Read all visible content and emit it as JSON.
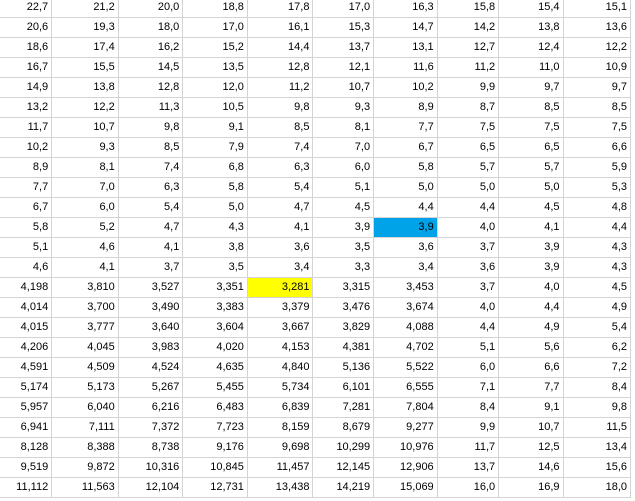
{
  "sheet": {
    "highlight_colors": {
      "yellow": "#ffff00",
      "blue": "#00a2e8"
    },
    "highlighted_cells": [
      {
        "row": 14,
        "col": 4,
        "color": "yellow"
      },
      {
        "row": 11,
        "col": 6,
        "color": "blue"
      }
    ],
    "rows": [
      [
        "22,7",
        "21,2",
        "20,0",
        "18,8",
        "17,8",
        "17,0",
        "16,3",
        "15,8",
        "15,4",
        "15,1"
      ],
      [
        "20,6",
        "19,3",
        "18,0",
        "17,0",
        "16,1",
        "15,3",
        "14,7",
        "14,2",
        "13,8",
        "13,6"
      ],
      [
        "18,6",
        "17,4",
        "16,2",
        "15,2",
        "14,4",
        "13,7",
        "13,1",
        "12,7",
        "12,4",
        "12,2"
      ],
      [
        "16,7",
        "15,5",
        "14,5",
        "13,5",
        "12,8",
        "12,1",
        "11,6",
        "11,2",
        "11,0",
        "10,9"
      ],
      [
        "14,9",
        "13,8",
        "12,8",
        "12,0",
        "11,2",
        "10,7",
        "10,2",
        "9,9",
        "9,7",
        "9,7"
      ],
      [
        "13,2",
        "12,2",
        "11,3",
        "10,5",
        "9,8",
        "9,3",
        "8,9",
        "8,7",
        "8,5",
        "8,5"
      ],
      [
        "11,7",
        "10,7",
        "9,8",
        "9,1",
        "8,5",
        "8,1",
        "7,7",
        "7,5",
        "7,5",
        "7,5"
      ],
      [
        "10,2",
        "9,3",
        "8,5",
        "7,9",
        "7,4",
        "7,0",
        "6,7",
        "6,5",
        "6,5",
        "6,6"
      ],
      [
        "8,9",
        "8,1",
        "7,4",
        "6,8",
        "6,3",
        "6,0",
        "5,8",
        "5,7",
        "5,7",
        "5,9"
      ],
      [
        "7,7",
        "7,0",
        "6,3",
        "5,8",
        "5,4",
        "5,1",
        "5,0",
        "5,0",
        "5,0",
        "5,3"
      ],
      [
        "6,7",
        "6,0",
        "5,4",
        "5,0",
        "4,7",
        "4,5",
        "4,4",
        "4,4",
        "4,5",
        "4,8"
      ],
      [
        "5,8",
        "5,2",
        "4,7",
        "4,3",
        "4,1",
        "3,9",
        "3,9",
        "4,0",
        "4,1",
        "4,4"
      ],
      [
        "5,1",
        "4,6",
        "4,1",
        "3,8",
        "3,6",
        "3,5",
        "3,6",
        "3,7",
        "3,9",
        "4,3"
      ],
      [
        "4,6",
        "4,1",
        "3,7",
        "3,5",
        "3,4",
        "3,3",
        "3,4",
        "3,6",
        "3,9",
        "4,3"
      ],
      [
        "4,198",
        "3,810",
        "3,527",
        "3,351",
        "3,281",
        "3,315",
        "3,453",
        "3,7",
        "4,0",
        "4,5"
      ],
      [
        "4,014",
        "3,700",
        "3,490",
        "3,383",
        "3,379",
        "3,476",
        "3,674",
        "4,0",
        "4,4",
        "4,9"
      ],
      [
        "4,015",
        "3,777",
        "3,640",
        "3,604",
        "3,667",
        "3,829",
        "4,088",
        "4,4",
        "4,9",
        "5,4"
      ],
      [
        "4,206",
        "4,045",
        "3,983",
        "4,020",
        "4,153",
        "4,381",
        "4,702",
        "5,1",
        "5,6",
        "6,2"
      ],
      [
        "4,591",
        "4,509",
        "4,524",
        "4,635",
        "4,840",
        "5,136",
        "5,522",
        "6,0",
        "6,6",
        "7,2"
      ],
      [
        "5,174",
        "5,173",
        "5,267",
        "5,455",
        "5,734",
        "6,101",
        "6,555",
        "7,1",
        "7,7",
        "8,4"
      ],
      [
        "5,957",
        "6,040",
        "6,216",
        "6,483",
        "6,839",
        "7,281",
        "7,804",
        "8,4",
        "9,1",
        "9,8"
      ],
      [
        "6,941",
        "7,111",
        "7,372",
        "7,723",
        "8,159",
        "8,679",
        "9,277",
        "9,9",
        "10,7",
        "11,5"
      ],
      [
        "8,128",
        "8,388",
        "8,738",
        "9,176",
        "9,698",
        "10,299",
        "10,976",
        "11,7",
        "12,5",
        "13,4"
      ],
      [
        "9,519",
        "9,872",
        "10,316",
        "10,845",
        "11,457",
        "12,145",
        "12,906",
        "13,7",
        "14,6",
        "15,6"
      ],
      [
        "11,112",
        "11,563",
        "12,104",
        "12,731",
        "13,438",
        "14,219",
        "15,069",
        "16,0",
        "16,9",
        "18,0"
      ]
    ]
  }
}
